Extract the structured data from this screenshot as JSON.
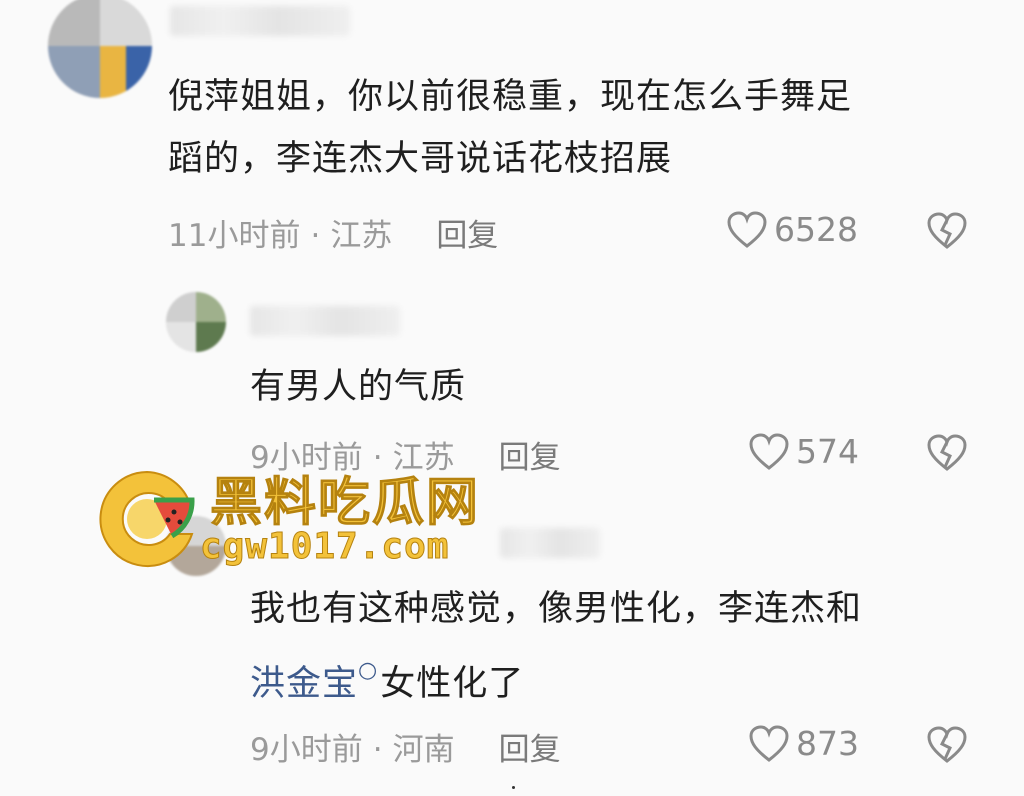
{
  "comments": [
    {
      "line1": "倪萍姐姐，你以前很稳重，现在怎么手舞足",
      "line2": "蹈的，李连杰大哥说话花枝招展",
      "time": "11小时前",
      "dot": "·",
      "location": "江苏",
      "reply": "回复",
      "likes": "6528"
    },
    {
      "line1": "有男人的气质",
      "time": "9小时前",
      "dot": "·",
      "location": "江苏",
      "reply": "回复",
      "likes": "574"
    },
    {
      "line1": "我也有这种感觉，像男性化，李连杰和",
      "link": "洪金宝",
      "line2_rest": "女性化了",
      "time": "9小时前",
      "dot": "·",
      "location": "河南",
      "reply": "回复",
      "likes": "873"
    }
  ],
  "watermark": {
    "title": "黑料吃瓜网",
    "url": "cgw1017.com"
  },
  "colors": {
    "text": "#1f1f1f",
    "meta": "#9a9a9a",
    "link": "#3d5a8c",
    "watermark": "#f3c23a"
  }
}
